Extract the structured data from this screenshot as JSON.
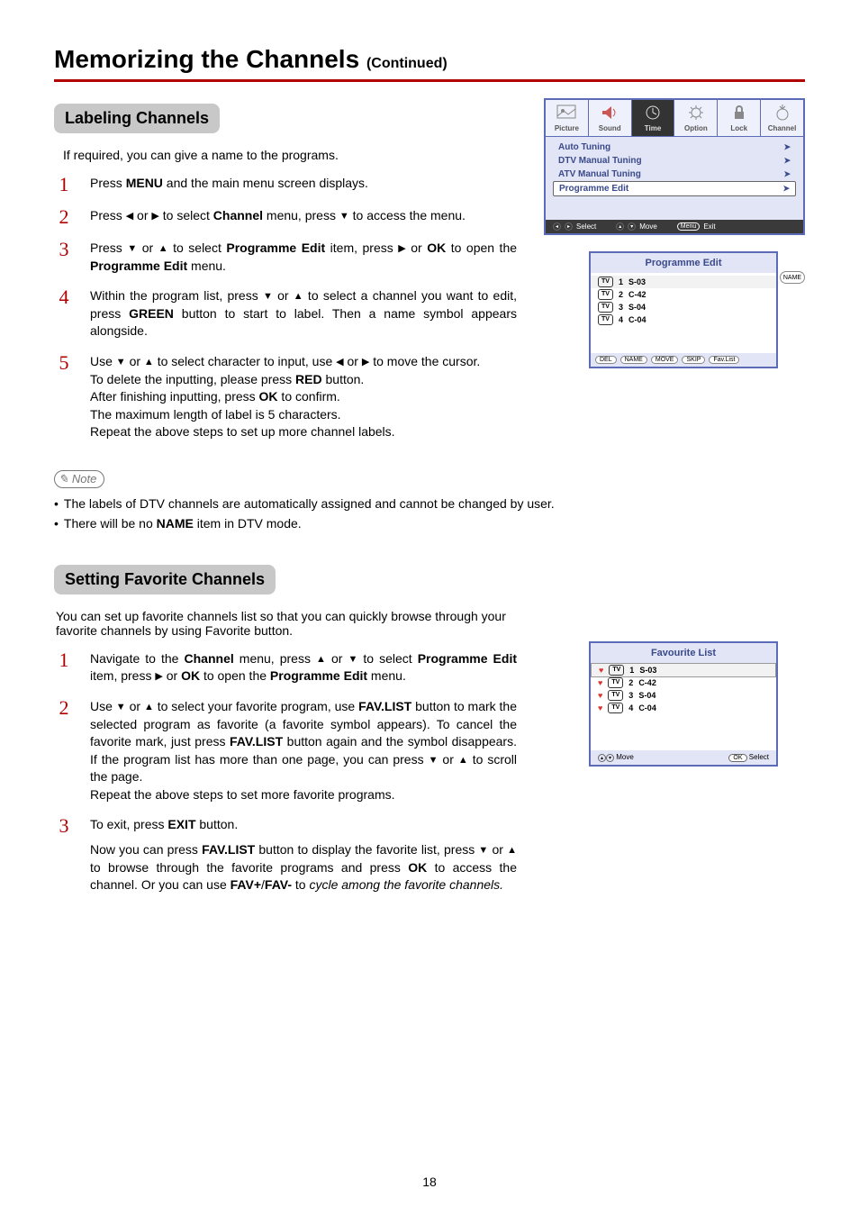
{
  "page": {
    "title": "Memorizing the Channels",
    "title_suffix": "(Continued)",
    "number": "18"
  },
  "section1": {
    "heading": "Labeling Channels",
    "intro": "If required, you can give a name to the programs.",
    "steps": {
      "s1": {
        "num": "1",
        "body_a": "Press ",
        "body_b": " and the main menu screen displays.",
        "bold1": "MENU"
      },
      "s2": {
        "num": "2",
        "body_a": "Press ",
        "body_b": " or ",
        "body_c": " to select ",
        "body_d": " menu,  press ",
        "body_e": " to access the menu.",
        "bold1": "Channel"
      },
      "s3": {
        "num": "3",
        "body_a": "Press ",
        "body_b": " or ",
        "body_c": " to select ",
        "body_d": " item, press ",
        "body_e": " or ",
        "body_f": " to open the ",
        "body_g": " menu.",
        "bold1": "Programme Edit",
        "bold2": "OK",
        "bold3": "Programme Edit"
      },
      "s4": {
        "num": "4",
        "body_a": "Within the program list,  press ",
        "body_b": " or ",
        "body_c": " to select a channel you want to edit, press ",
        "body_d": " button to start to label. Then a name symbol appears alongside.",
        "bold1": "GREEN"
      },
      "s5": {
        "num": "5",
        "l1a": "Use ",
        "l1b": " or ",
        "l1c": " to select character to input, use ",
        "l1d": " or ",
        "l1e": " to move the cursor.",
        "l2a": "To delete the inputting, please press ",
        "l2b": " button.",
        "l2bold": "RED",
        "l3a": "After finishing inputting, press ",
        "l3b": " to confirm.",
        "l3bold": "OK",
        "l4": "The maximum length of label is 5 characters.",
        "l5": "Repeat the above steps to set up more channel labels."
      }
    },
    "note_label": "Note",
    "notes": {
      "n1": "The labels of DTV channels are automatically assigned and cannot be changed by user.",
      "n2a": "There will be no ",
      "n2b": " item in DTV mode.",
      "n2bold": "NAME"
    }
  },
  "section2": {
    "heading": "Setting Favorite Channels",
    "intro": "You can set up favorite channels list so that you can quickly browse through your favorite channels by using Favorite button.",
    "steps": {
      "s1": {
        "num": "1",
        "a": "Navigate to the ",
        "b": " menu,  press ",
        "c": " or ",
        "d": " to select ",
        "e": " item, press ",
        "f": " or ",
        "g": " to open the ",
        "h": " menu.",
        "bold1": "Channel",
        "bold2": "Programme Edit",
        "bold3": "OK",
        "bold4": "Programme Edit"
      },
      "s2": {
        "num": "2",
        "a": "Use ",
        "b": " or ",
        "c": " to select your favorite program, use ",
        "d": " button to mark the selected program as favorite (a favorite symbol appears).  To cancel the favorite mark, just press ",
        "e": " button again and the symbol disappears. If the program list has more than one page, you can press ",
        "f": " or ",
        "g": " to scroll the page.",
        "line2": "Repeat the above steps to set more favorite programs.",
        "bold1": "FAV.LIST",
        "bold2": "FAV.LIST"
      },
      "s3": {
        "num": "3",
        "a": "To exit, press ",
        "b": " button.",
        "bold1": "EXIT",
        "p2a": "Now you can press ",
        "p2b": " button to display the favorite list, press ",
        "p2c": " or ",
        "p2d": " to browse through the favorite programs and press ",
        "p2e": " to access the channel. Or you can use ",
        "p2f": "/",
        "p2g": " to ",
        "p2h": "cycle among the favorite channels.",
        "bold2": "FAV.LIST",
        "bold3": "OK",
        "bold4": "FAV+",
        "bold5": "FAV-"
      }
    }
  },
  "osd": {
    "tabs": {
      "t1": "Picture",
      "t2": "Sound",
      "t3": "Time",
      "t4": "Option",
      "t5": "Lock",
      "t6": "Channel"
    },
    "items": {
      "i1": "Auto Tuning",
      "i2": "DTV Manual Tuning",
      "i3": "ATV Manual Tuning",
      "i4": "Programme Edit"
    },
    "footer": {
      "select": "Select",
      "move": "Move",
      "menu": "Menu",
      "exit": "Exit"
    }
  },
  "pe": {
    "title": "Programme Edit",
    "tv": "TV",
    "rows": [
      {
        "n": "1",
        "c": "S-03"
      },
      {
        "n": "2",
        "c": "C-42"
      },
      {
        "n": "3",
        "c": "S-04"
      },
      {
        "n": "4",
        "c": "C-04"
      }
    ],
    "name": "NAME",
    "foot": {
      "b1": "DEL",
      "b2": "NAME",
      "b3": "MOVE",
      "b4": "SKIP",
      "b5": "Fav.List"
    }
  },
  "fav": {
    "title": "Favourite List",
    "tv": "TV",
    "rows": [
      {
        "n": "1",
        "c": "S-03"
      },
      {
        "n": "2",
        "c": "C-42"
      },
      {
        "n": "3",
        "c": "S-04"
      },
      {
        "n": "4",
        "c": "C-04"
      }
    ],
    "foot": {
      "move": "Move",
      "select": "Select",
      "ok": "OK"
    }
  }
}
